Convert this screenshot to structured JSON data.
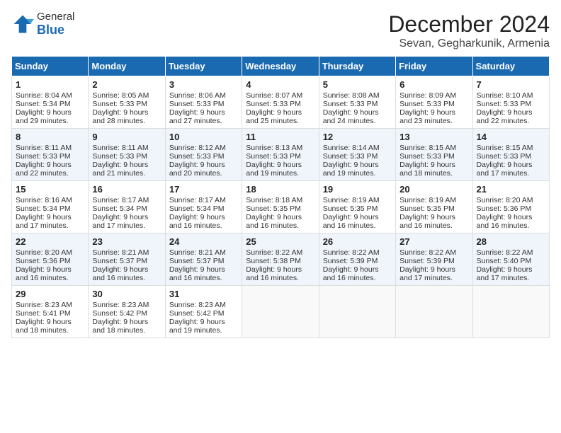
{
  "logo": {
    "general": "General",
    "blue": "Blue"
  },
  "title": "December 2024",
  "subtitle": "Sevan, Gegharkunik, Armenia",
  "days_of_week": [
    "Sunday",
    "Monday",
    "Tuesday",
    "Wednesday",
    "Thursday",
    "Friday",
    "Saturday"
  ],
  "weeks": [
    [
      {
        "day": "1",
        "sunrise": "Sunrise: 8:04 AM",
        "sunset": "Sunset: 5:34 PM",
        "daylight": "Daylight: 9 hours and 29 minutes."
      },
      {
        "day": "2",
        "sunrise": "Sunrise: 8:05 AM",
        "sunset": "Sunset: 5:33 PM",
        "daylight": "Daylight: 9 hours and 28 minutes."
      },
      {
        "day": "3",
        "sunrise": "Sunrise: 8:06 AM",
        "sunset": "Sunset: 5:33 PM",
        "daylight": "Daylight: 9 hours and 27 minutes."
      },
      {
        "day": "4",
        "sunrise": "Sunrise: 8:07 AM",
        "sunset": "Sunset: 5:33 PM",
        "daylight": "Daylight: 9 hours and 25 minutes."
      },
      {
        "day": "5",
        "sunrise": "Sunrise: 8:08 AM",
        "sunset": "Sunset: 5:33 PM",
        "daylight": "Daylight: 9 hours and 24 minutes."
      },
      {
        "day": "6",
        "sunrise": "Sunrise: 8:09 AM",
        "sunset": "Sunset: 5:33 PM",
        "daylight": "Daylight: 9 hours and 23 minutes."
      },
      {
        "day": "7",
        "sunrise": "Sunrise: 8:10 AM",
        "sunset": "Sunset: 5:33 PM",
        "daylight": "Daylight: 9 hours and 22 minutes."
      }
    ],
    [
      {
        "day": "8",
        "sunrise": "Sunrise: 8:11 AM",
        "sunset": "Sunset: 5:33 PM",
        "daylight": "Daylight: 9 hours and 22 minutes."
      },
      {
        "day": "9",
        "sunrise": "Sunrise: 8:11 AM",
        "sunset": "Sunset: 5:33 PM",
        "daylight": "Daylight: 9 hours and 21 minutes."
      },
      {
        "day": "10",
        "sunrise": "Sunrise: 8:12 AM",
        "sunset": "Sunset: 5:33 PM",
        "daylight": "Daylight: 9 hours and 20 minutes."
      },
      {
        "day": "11",
        "sunrise": "Sunrise: 8:13 AM",
        "sunset": "Sunset: 5:33 PM",
        "daylight": "Daylight: 9 hours and 19 minutes."
      },
      {
        "day": "12",
        "sunrise": "Sunrise: 8:14 AM",
        "sunset": "Sunset: 5:33 PM",
        "daylight": "Daylight: 9 hours and 19 minutes."
      },
      {
        "day": "13",
        "sunrise": "Sunrise: 8:15 AM",
        "sunset": "Sunset: 5:33 PM",
        "daylight": "Daylight: 9 hours and 18 minutes."
      },
      {
        "day": "14",
        "sunrise": "Sunrise: 8:15 AM",
        "sunset": "Sunset: 5:33 PM",
        "daylight": "Daylight: 9 hours and 17 minutes."
      }
    ],
    [
      {
        "day": "15",
        "sunrise": "Sunrise: 8:16 AM",
        "sunset": "Sunset: 5:34 PM",
        "daylight": "Daylight: 9 hours and 17 minutes."
      },
      {
        "day": "16",
        "sunrise": "Sunrise: 8:17 AM",
        "sunset": "Sunset: 5:34 PM",
        "daylight": "Daylight: 9 hours and 17 minutes."
      },
      {
        "day": "17",
        "sunrise": "Sunrise: 8:17 AM",
        "sunset": "Sunset: 5:34 PM",
        "daylight": "Daylight: 9 hours and 16 minutes."
      },
      {
        "day": "18",
        "sunrise": "Sunrise: 8:18 AM",
        "sunset": "Sunset: 5:35 PM",
        "daylight": "Daylight: 9 hours and 16 minutes."
      },
      {
        "day": "19",
        "sunrise": "Sunrise: 8:19 AM",
        "sunset": "Sunset: 5:35 PM",
        "daylight": "Daylight: 9 hours and 16 minutes."
      },
      {
        "day": "20",
        "sunrise": "Sunrise: 8:19 AM",
        "sunset": "Sunset: 5:35 PM",
        "daylight": "Daylight: 9 hours and 16 minutes."
      },
      {
        "day": "21",
        "sunrise": "Sunrise: 8:20 AM",
        "sunset": "Sunset: 5:36 PM",
        "daylight": "Daylight: 9 hours and 16 minutes."
      }
    ],
    [
      {
        "day": "22",
        "sunrise": "Sunrise: 8:20 AM",
        "sunset": "Sunset: 5:36 PM",
        "daylight": "Daylight: 9 hours and 16 minutes."
      },
      {
        "day": "23",
        "sunrise": "Sunrise: 8:21 AM",
        "sunset": "Sunset: 5:37 PM",
        "daylight": "Daylight: 9 hours and 16 minutes."
      },
      {
        "day": "24",
        "sunrise": "Sunrise: 8:21 AM",
        "sunset": "Sunset: 5:37 PM",
        "daylight": "Daylight: 9 hours and 16 minutes."
      },
      {
        "day": "25",
        "sunrise": "Sunrise: 8:22 AM",
        "sunset": "Sunset: 5:38 PM",
        "daylight": "Daylight: 9 hours and 16 minutes."
      },
      {
        "day": "26",
        "sunrise": "Sunrise: 8:22 AM",
        "sunset": "Sunset: 5:39 PM",
        "daylight": "Daylight: 9 hours and 16 minutes."
      },
      {
        "day": "27",
        "sunrise": "Sunrise: 8:22 AM",
        "sunset": "Sunset: 5:39 PM",
        "daylight": "Daylight: 9 hours and 17 minutes."
      },
      {
        "day": "28",
        "sunrise": "Sunrise: 8:22 AM",
        "sunset": "Sunset: 5:40 PM",
        "daylight": "Daylight: 9 hours and 17 minutes."
      }
    ],
    [
      {
        "day": "29",
        "sunrise": "Sunrise: 8:23 AM",
        "sunset": "Sunset: 5:41 PM",
        "daylight": "Daylight: 9 hours and 18 minutes."
      },
      {
        "day": "30",
        "sunrise": "Sunrise: 8:23 AM",
        "sunset": "Sunset: 5:42 PM",
        "daylight": "Daylight: 9 hours and 18 minutes."
      },
      {
        "day": "31",
        "sunrise": "Sunrise: 8:23 AM",
        "sunset": "Sunset: 5:42 PM",
        "daylight": "Daylight: 9 hours and 19 minutes."
      },
      null,
      null,
      null,
      null
    ]
  ]
}
